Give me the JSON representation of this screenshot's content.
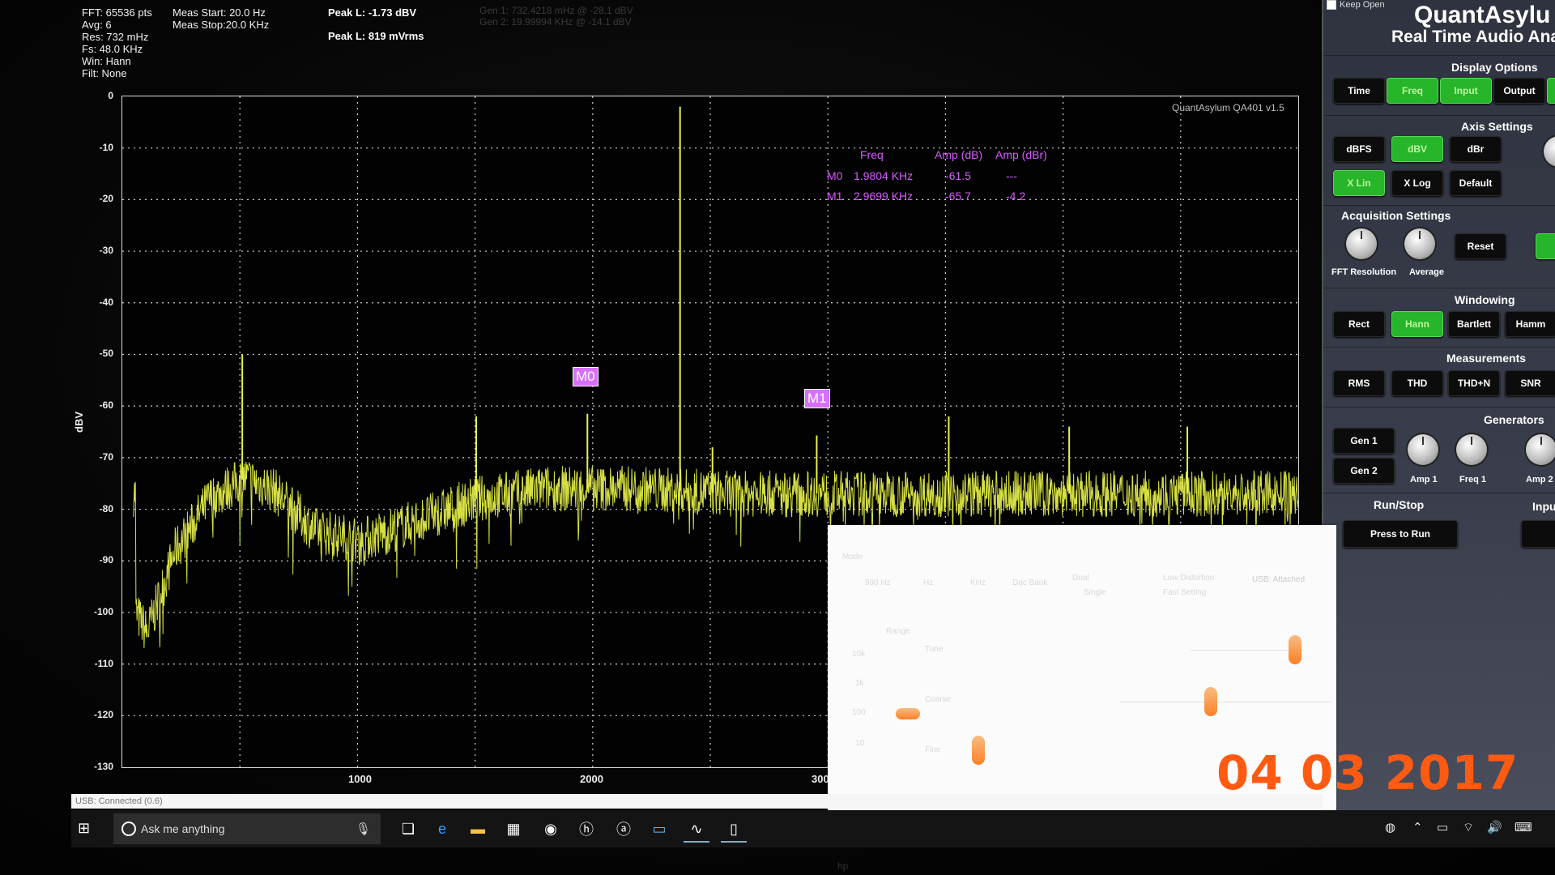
{
  "stats_left": [
    "FFT: 65536 pts",
    "Avg: 6",
    "Res: 732 mHz",
    "Fs: 48.0 KHz",
    "Win: Hann",
    "Filt: None"
  ],
  "meas": {
    "start": "Meas Start: 20.0 Hz",
    "stop": "Meas Stop:20.0 KHz"
  },
  "peak": {
    "db": "Peak L: -1.73 dBV",
    "mv": "Peak L: 819 mVrms"
  },
  "gen_info": [
    "Gen 1: 732.4218 mHz @ -28.1 dBV",
    "Gen 2: 19.99994 KHz @ -14.1 dBV"
  ],
  "watermark": "QuantAsylum QA401 v1.5",
  "y_axis_title": "dBV",
  "y_ticks": [
    "0",
    "-10",
    "-20",
    "-30",
    "-40",
    "-50",
    "-60",
    "-70",
    "-80",
    "-90",
    "-100",
    "-110",
    "-120",
    "-130"
  ],
  "x_ticks": [
    "1000",
    "2000",
    "300"
  ],
  "marker_table": {
    "headers": [
      "Freq",
      "Amp (dB)",
      "Amp (dBr)"
    ],
    "rows": [
      {
        "name": "M0",
        "freq": "1.9804 KHz",
        "amp": "-61.5",
        "ampr": "---"
      },
      {
        "name": "M1",
        "freq": "2.9699 KHz",
        "amp": "-65.7",
        "ampr": "-4.2"
      }
    ]
  },
  "markers": [
    {
      "label": "M0"
    },
    {
      "label": "M1"
    }
  ],
  "chart_data": {
    "type": "line",
    "ylabel": "dBV",
    "ylim": [
      -130,
      0
    ],
    "xticks": [
      1000,
      2000
    ],
    "series": [
      {
        "values_approx": [
          [
            30,
            -100
          ],
          [
            80,
            -104
          ],
          [
            200,
            -88
          ],
          [
            350,
            -78
          ],
          [
            500,
            -74
          ],
          [
            620,
            -76
          ],
          [
            800,
            -84
          ],
          [
            1000,
            -86
          ],
          [
            1200,
            -83
          ],
          [
            1500,
            -78
          ],
          [
            1800,
            -76
          ],
          [
            2200,
            -76
          ],
          [
            2600,
            -77
          ],
          [
            3000,
            -77
          ],
          [
            3500,
            -77
          ],
          [
            4000,
            -77
          ],
          [
            4600,
            -77
          ],
          [
            5000,
            -77
          ]
        ],
        "spikes": [
          [
            490,
            -50
          ],
          [
            2380,
            -2
          ],
          [
            1980,
            -61.5
          ],
          [
            2970,
            -65.7
          ],
          [
            1500,
            -62
          ],
          [
            2520,
            -68
          ],
          [
            3540,
            -62
          ],
          [
            4060,
            -64
          ],
          [
            4570,
            -64
          ],
          [
            5080,
            -66
          ]
        ]
      }
    ],
    "color": "#e8f24a",
    "grid": true
  },
  "panel": {
    "keep_open": "Keep Open",
    "brand_line1": "QuantAsylu",
    "brand_line2": "Real Time Audio Ana",
    "sections": {
      "display": "Display Options",
      "axis": "Axis Settings",
      "acq": "Acquisition Settings",
      "windowing": "Windowing",
      "measurements": "Measurements",
      "generators": "Generators",
      "runstop": "Run/Stop",
      "input": "Inpu"
    },
    "display_buttons": [
      {
        "label": "Time",
        "on": false
      },
      {
        "label": "Freq",
        "on": true
      },
      {
        "label": "Input",
        "on": true
      },
      {
        "label": "Output",
        "on": false
      }
    ],
    "axis_buttons_row1": [
      {
        "label": "dBFS",
        "on": false
      },
      {
        "label": "dBV",
        "on": true
      },
      {
        "label": "dBr",
        "on": false
      }
    ],
    "axis_buttons_row2": [
      {
        "label": "X Lin",
        "on": true
      },
      {
        "label": "X Log",
        "on": false
      },
      {
        "label": "Default",
        "on": false
      }
    ],
    "acq": {
      "fft_res": "FFT Resolution",
      "average": "Average",
      "reset": "Reset"
    },
    "window_buttons": [
      {
        "label": "Rect",
        "on": false
      },
      {
        "label": "Hann",
        "on": true
      },
      {
        "label": "Bartlett",
        "on": false
      },
      {
        "label": "Hamm",
        "on": false
      }
    ],
    "meas_buttons": [
      {
        "label": "RMS"
      },
      {
        "label": "THD"
      },
      {
        "label": "THD+N"
      },
      {
        "label": "SNR"
      }
    ],
    "gen_buttons": [
      "Gen 1",
      "Gen 2"
    ],
    "gen_knobs": [
      "Amp 1",
      "Freq 1",
      "Amp 2"
    ],
    "run_label": "Press to Run"
  },
  "usb_status": "USB: Connected  (0.6)",
  "search_placeholder": "Ask me anything",
  "dialog": {
    "mode": "Mode",
    "freq": "990 Hz",
    "opt1": "Hz",
    "opt2": "KHz",
    "dac": "Dac Bank",
    "dual": "Dual",
    "single": "Single",
    "lowdist": "Low Distortion",
    "fast": "Fast Setting",
    "usb": "USB: Attached",
    "range": "Range",
    "r1": "10k",
    "r2": "1k",
    "r3": "100",
    "r4": "10",
    "tune": "Tune",
    "coarse": "Coarse",
    "fine": "Fine"
  },
  "date_stamp": "04  03  2017"
}
